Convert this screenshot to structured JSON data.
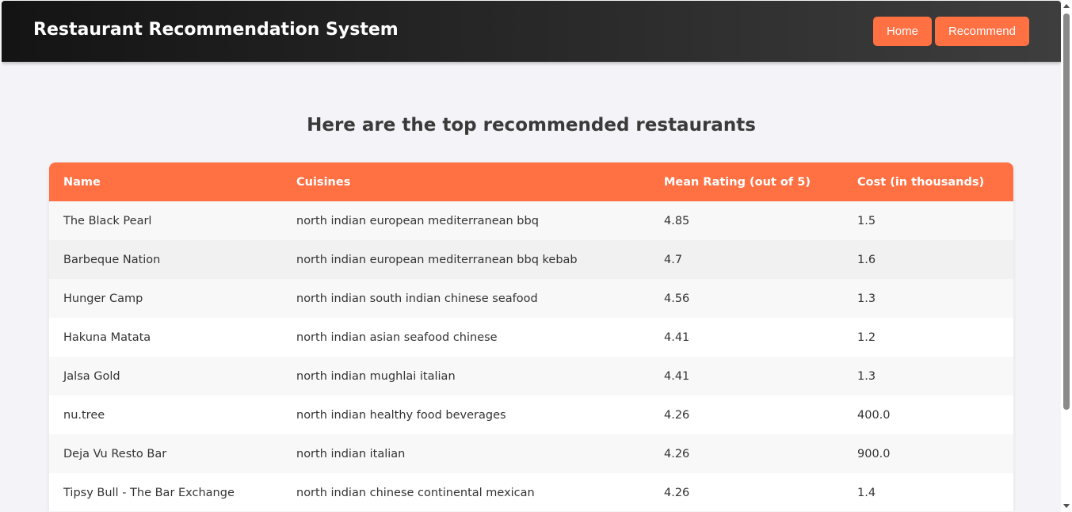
{
  "navbar": {
    "title": "Restaurant Recommendation System",
    "buttons": [
      {
        "label": "Home"
      },
      {
        "label": "Recommend"
      }
    ]
  },
  "main": {
    "heading": "Here are the top recommended restaurants"
  },
  "table": {
    "columns": [
      "Name",
      "Cuisines",
      "Mean Rating (out of 5)",
      "Cost (in thousands)"
    ],
    "rows": [
      {
        "name": "The Black Pearl",
        "cuisines": "north indian european mediterranean bbq",
        "rating": "4.85",
        "cost": "1.5"
      },
      {
        "name": "Barbeque Nation",
        "cuisines": "north indian european mediterranean bbq kebab",
        "rating": "4.7",
        "cost": "1.6"
      },
      {
        "name": "Hunger Camp",
        "cuisines": "north indian south indian chinese seafood",
        "rating": "4.56",
        "cost": "1.3"
      },
      {
        "name": "Hakuna Matata",
        "cuisines": "north indian asian seafood chinese",
        "rating": "4.41",
        "cost": "1.2"
      },
      {
        "name": "Jalsa Gold",
        "cuisines": "north indian mughlai italian",
        "rating": "4.41",
        "cost": "1.3"
      },
      {
        "name": "nu.tree",
        "cuisines": "north indian healthy food beverages",
        "rating": "4.26",
        "cost": "400.0"
      },
      {
        "name": "Deja Vu Resto Bar",
        "cuisines": "north indian italian",
        "rating": "4.26",
        "cost": "900.0"
      },
      {
        "name": "Tipsy Bull - The Bar Exchange",
        "cuisines": "north indian chinese continental mexican",
        "rating": "4.26",
        "cost": "1.4"
      }
    ]
  },
  "colors": {
    "accent": "#ff7043",
    "navbar_dark": "#141414",
    "page_bg": "#f4f4f8"
  }
}
